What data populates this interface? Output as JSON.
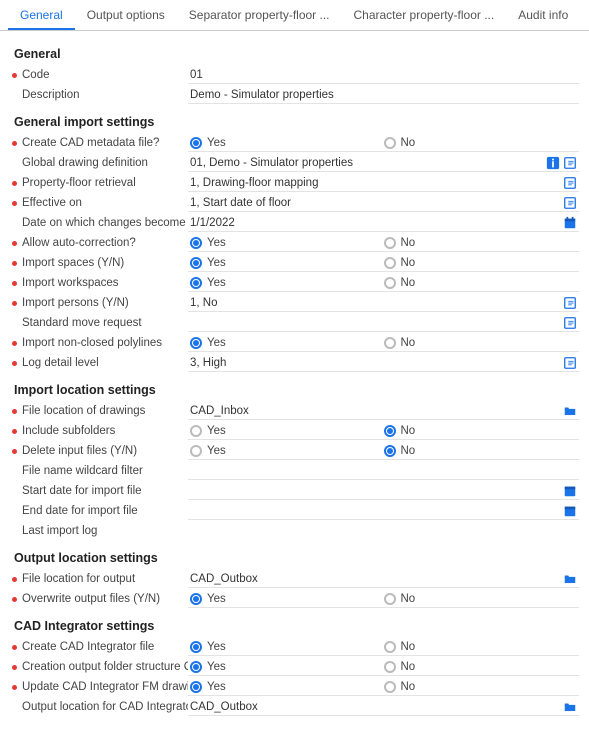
{
  "tabs": [
    "General",
    "Output options",
    "Separator property-floor ...",
    "Character property-floor ...",
    "Audit info"
  ],
  "active_tab": 0,
  "yes": "Yes",
  "no": "No",
  "sections": {
    "general": {
      "title": "General",
      "code_label": "Code",
      "code_value": "01",
      "desc_label": "Description",
      "desc_value": "Demo - Simulator properties"
    },
    "import": {
      "title": "General import settings",
      "create_meta_label": "Create CAD metadata file?",
      "create_meta": "yes",
      "gdd_label": "Global drawing definition",
      "gdd_value": "01, Demo - Simulator properties",
      "pfr_label": "Property-floor retrieval",
      "pfr_value": "1, Drawing-floor mapping",
      "eff_label": "Effective on",
      "eff_value": "1, Start date of floor",
      "date_changes_label": "Date on which changes become effective",
      "date_changes_value": "1/1/2022",
      "auto_corr_label": "Allow auto-correction?",
      "auto_corr": "yes",
      "imp_spaces_label": "Import spaces (Y/N)",
      "imp_spaces": "yes",
      "imp_ws_label": "Import workspaces",
      "imp_ws": "yes",
      "imp_persons_label": "Import persons (Y/N)",
      "imp_persons_value": "1, No",
      "std_move_label": "Standard move request",
      "std_move_value": "",
      "imp_poly_label": "Import non-closed polylines",
      "imp_poly": "yes",
      "log_label": "Log detail level",
      "log_value": "3, High"
    },
    "import_loc": {
      "title": "Import location settings",
      "file_loc_label": "File location of drawings",
      "file_loc_value": "CAD_Inbox",
      "inc_sub_label": "Include subfolders",
      "inc_sub": "no",
      "del_input_label": "Delete input files (Y/N)",
      "del_input": "no",
      "wildcard_label": "File name wildcard filter",
      "wildcard_value": "",
      "start_date_label": "Start date for import file",
      "start_date_value": "",
      "end_date_label": "End date for import file",
      "end_date_value": "",
      "last_log_label": "Last import log",
      "last_log_value": ""
    },
    "output_loc": {
      "title": "Output location settings",
      "file_out_label": "File location for output",
      "file_out_value": "CAD_Outbox",
      "overwrite_label": "Overwrite output files (Y/N)",
      "overwrite": "yes"
    },
    "cad_int": {
      "title": "CAD Integrator settings",
      "create_ci_label": "Create CAD Integrator file",
      "create_ci": "yes",
      "creation_out_label": "Creation output folder structure CAD In...",
      "creation_out": "yes",
      "update_fm_label": "Update CAD Integrator FM drawing",
      "update_fm": "yes",
      "out_loc_label": "Output location for CAD Integrator files",
      "out_loc_value": "CAD_Outbox"
    }
  }
}
